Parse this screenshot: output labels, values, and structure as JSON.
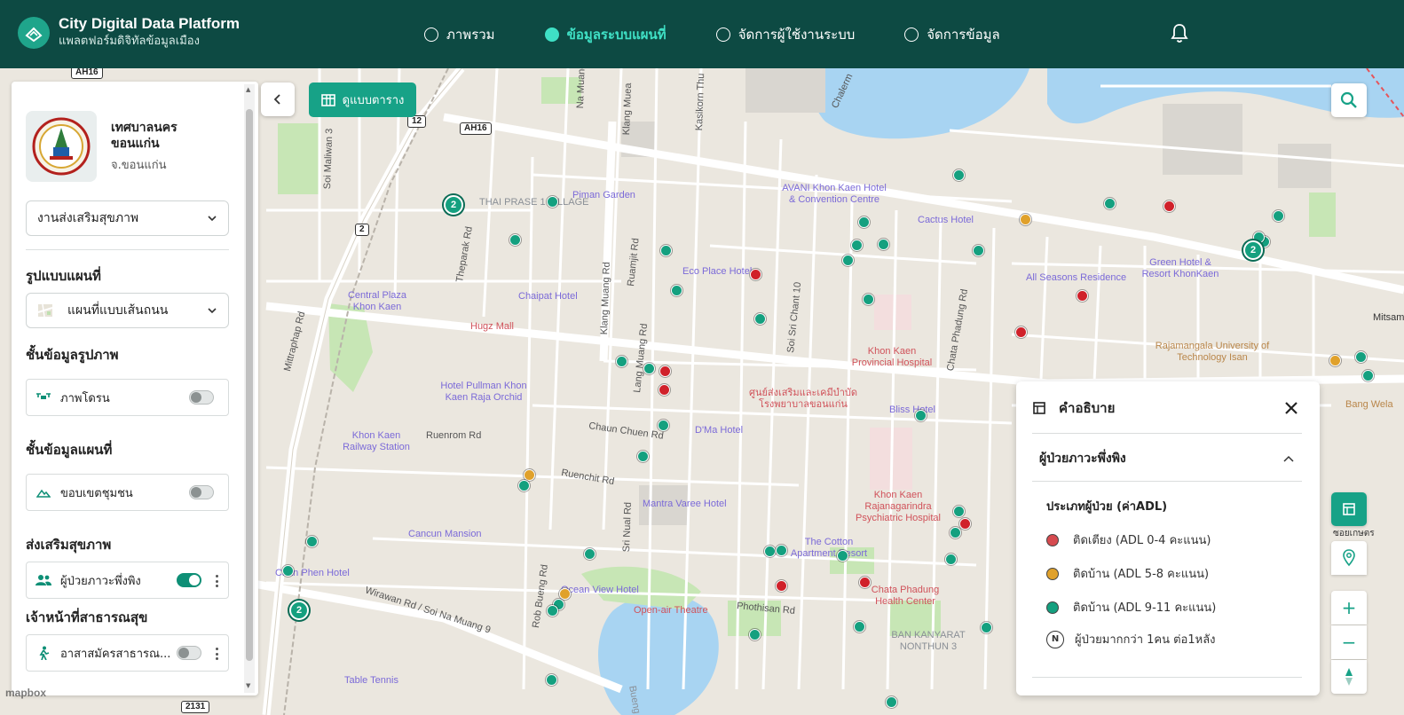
{
  "header": {
    "title": "City Digital Data Platform",
    "subtitle": "แพลตฟอร์มดิจิทัลข้อมูลเมือง",
    "nav": [
      {
        "label": "ภาพรวม",
        "active": false
      },
      {
        "label": "ข้อมูลระบบแผนที่",
        "active": true
      },
      {
        "label": "จัดการผู้ใช้งานระบบ",
        "active": false
      },
      {
        "label": "จัดการข้อมูล",
        "active": false
      }
    ],
    "bell_icon": "bell-icon"
  },
  "sidebar": {
    "org_name": "เทศบาลนครขอนแก่น",
    "org_province": "จ.ขอนแก่น",
    "category_select": "งานส่งเสริมสุขภาพ",
    "map_style_title": "รูปแบบแผนที่",
    "map_style_select": "แผนที่แบบเส้นถนน",
    "image_layers_title": "ชั้นข้อมูลรูปภาพ",
    "drone_label": "ภาพโดรน",
    "drone_on": false,
    "map_layers_title": "ชั้นข้อมูลแผนที่",
    "community_label": "ขอบเขตชุมชน",
    "community_on": false,
    "health_title": "ส่งเสริมสุขภาพ",
    "dependent_label": "ผู้ป่วยภาวะพึ่งพิง",
    "dependent_on": true,
    "staff_title": "เจ้าหน้าที่สาธารณสุข",
    "volunteer_label": "อาสาสมัครสาธารณ...",
    "volunteer_on": false
  },
  "toolbar": {
    "table_view_label": "ดูแบบตาราง"
  },
  "legend": {
    "title": "คำอธิบาย",
    "group": "ผู้ป่วยภาวะพึ่งพิง",
    "subtitle": "ประเภทผู้ป่วย (ค่าADL)",
    "items": [
      {
        "label": "ติดเตียง (ADL 0-4 คะแนน)",
        "color": "#d64a4f"
      },
      {
        "label": "ติดบ้าน (ADL 5-8 คะแนน)",
        "color": "#e0a12b"
      },
      {
        "label": "ติดบ้าน (ADL 9-11 คะแนน)",
        "color": "#14a07f"
      }
    ],
    "n_badge": "N",
    "n_label": "ผู้ป่วยมากกว่า 1คน ต่อ1หลัง"
  },
  "map": {
    "attribution": "mapbox",
    "cluster_label": "2",
    "road_labels": [
      "Mittraphap Rd",
      "Theparak Rd",
      "Na Muang Rd",
      "Klang Muang Rd",
      "Lang Muang Rd",
      "Ruamjit Rd",
      "Soi Sri Chant 10",
      "Chata Phadung Rd",
      "Chaun Chuen Rd",
      "Ruenrom Rd",
      "Ruenchit Rd",
      "Sri Nual Rd",
      "Phothisan Rd",
      "Wirawan Rd / Soi Na Muang 9",
      "Soi Maliwan 3",
      "Rob Bueng Rd",
      "Klang Muea",
      "Kasikorn Thu",
      "Chalerm"
    ],
    "poi_labels": [
      "THAI PRASE 1 VILLAGE",
      "Piman Garden",
      "AVANI Khon Kaen Hotel & Convention Centre",
      "Cactus Hotel",
      "Eco Place Hotel",
      "Chaipat Hotel",
      "Central Plaza Khon Kaen",
      "Hugz Mall",
      "Hotel Pullman Khon Kaen Raja Orchid",
      "Khon Kaen Provincial Hospital",
      "All Seasons Residence",
      "Green Hotel & Resort KhonKaen",
      "Rajamangala University of Technology Isan",
      "ศูนย์ส่งเสริมและเคมีบำบัด โรงพยาบาลขอนแก่น",
      "D'Ma Hotel",
      "Bliss Hotel",
      "Khon Kaen Railway Station",
      "Mantra Varee Hotel",
      "Khon Kaen Rajanagarindra Psychiatric Hospital",
      "Cancun Mansion",
      "The Cotton Apartment Resort",
      "Chata Phadung Health Center",
      "Chan Phen Hotel",
      "Ocean View Hotel",
      "Open-air Theatre",
      "BAN KANYARAT NONTHUN 3",
      "Table Tennis",
      "Bueng Kaen",
      "Bang Wela",
      "Mitsamp",
      "ซอยเกษตร"
    ]
  }
}
